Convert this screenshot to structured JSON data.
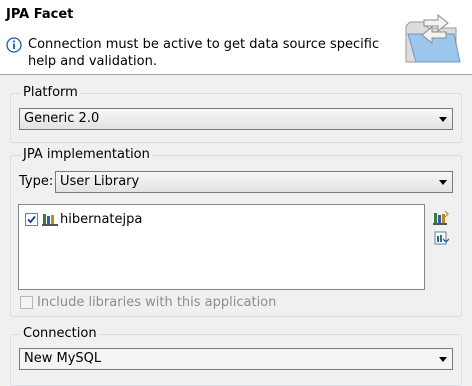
{
  "header": {
    "title": "JPA Facet",
    "message": "Connection must be active to get data source specific help and validation."
  },
  "platform": {
    "group_label": "Platform",
    "selected": "Generic 2.0"
  },
  "jpa_implementation": {
    "group_label": "JPA implementation",
    "type_label": "Type:",
    "type_selected": "User Library",
    "libraries": [
      {
        "name": "hibernatejpa",
        "checked": true
      }
    ],
    "include_checkbox_label": "Include libraries with this application"
  },
  "connection": {
    "group_label": "Connection",
    "selected": "New MySQL"
  },
  "colors": {
    "info_blue": "#1e5aa8",
    "folder_blue": "#9cc6ea"
  }
}
